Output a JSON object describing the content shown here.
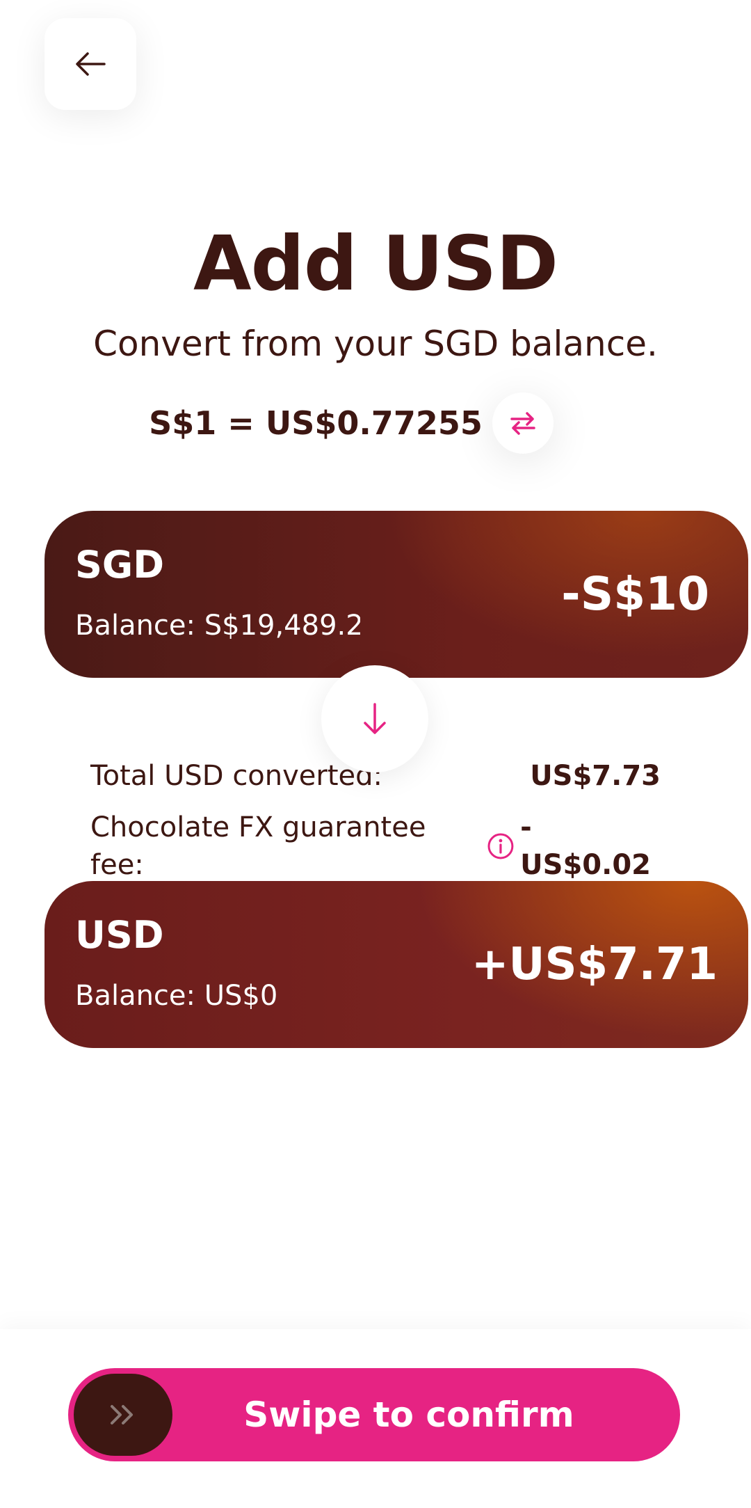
{
  "header": {
    "back_icon": "arrow-left-icon"
  },
  "title": "Add USD",
  "subtitle": "Convert from your SGD balance.",
  "rate": {
    "text": "S$1 = US$0.77255",
    "swap_icon": "swap-arrows-icon"
  },
  "from_card": {
    "currency": "SGD",
    "balance": "Balance: S$19,489.22",
    "amount": "-S$10"
  },
  "to_card": {
    "currency": "USD",
    "balance": "Balance: US$0",
    "amount": "+US$7.71"
  },
  "details": {
    "total_label": "Total USD converted:",
    "total_value": "US$7.73",
    "fee_label": "Chocolate FX guarantee fee:",
    "fee_value": "-US$0.02"
  },
  "swipe": {
    "label": "Swipe to confirm",
    "handle_icon": "double-chevron-right-icon"
  },
  "colors": {
    "brand_dark": "#3d1712",
    "accent_pink": "#e62383",
    "card_red": "#6b1f1b",
    "card_orange": "#b05014"
  }
}
